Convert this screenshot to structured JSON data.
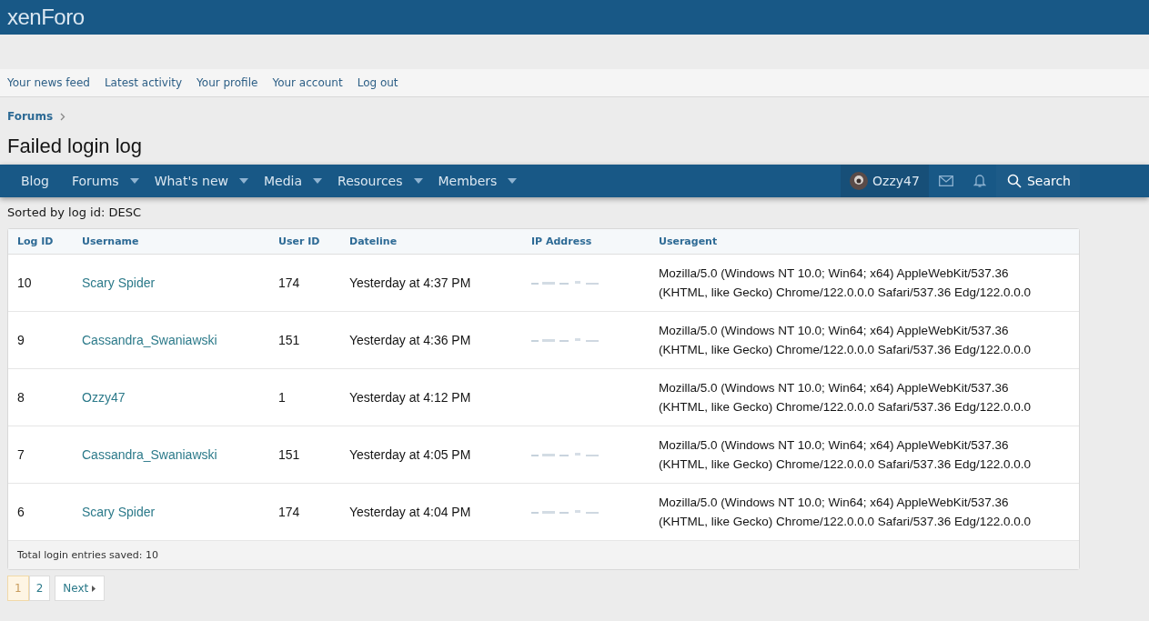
{
  "logo": "xenForo",
  "account_links": [
    {
      "label": "Your news feed"
    },
    {
      "label": "Latest activity"
    },
    {
      "label": "Your profile"
    },
    {
      "label": "Your account"
    },
    {
      "label": "Log out"
    }
  ],
  "breadcrumb": "Forums",
  "title": "Failed login log",
  "nav": [
    {
      "label": "Blog",
      "has_menu": false
    },
    {
      "label": "Forums",
      "has_menu": true
    },
    {
      "label": "What's new",
      "has_menu": true
    },
    {
      "label": "Media",
      "has_menu": true
    },
    {
      "label": "Resources",
      "has_menu": true
    },
    {
      "label": "Members",
      "has_menu": true
    }
  ],
  "user": {
    "name": "Ozzy47"
  },
  "search_label": "Search",
  "sort_note": "Sorted by log id: DESC",
  "table": {
    "columns": [
      "Log ID",
      "Username",
      "User ID",
      "Dateline",
      "IP Address",
      "Useragent"
    ],
    "rows": [
      {
        "log_id": "10",
        "username": "Scary Spider",
        "user_id": "174",
        "dateline": "Yesterday at 4:37 PM",
        "ip_masked": true,
        "useragent": "Mozilla/5.0 (Windows NT 10.0; Win64; x64) AppleWebKit/537.36 (KHTML, like Gecko) Chrome/122.0.0.0 Safari/537.36 Edg/122.0.0.0"
      },
      {
        "log_id": "9",
        "username": "Cassandra_Swaniawski",
        "user_id": "151",
        "dateline": "Yesterday at 4:36 PM",
        "ip_masked": true,
        "useragent": "Mozilla/5.0 (Windows NT 10.0; Win64; x64) AppleWebKit/537.36 (KHTML, like Gecko) Chrome/122.0.0.0 Safari/537.36 Edg/122.0.0.0"
      },
      {
        "log_id": "8",
        "username": "Ozzy47",
        "user_id": "1",
        "dateline": "Yesterday at 4:12 PM",
        "ip_masked": false,
        "useragent": "Mozilla/5.0 (Windows NT 10.0; Win64; x64) AppleWebKit/537.36 (KHTML, like Gecko) Chrome/122.0.0.0 Safari/537.36 Edg/122.0.0.0"
      },
      {
        "log_id": "7",
        "username": "Cassandra_Swaniawski",
        "user_id": "151",
        "dateline": "Yesterday at 4:05 PM",
        "ip_masked": true,
        "useragent": "Mozilla/5.0 (Windows NT 10.0; Win64; x64) AppleWebKit/537.36 (KHTML, like Gecko) Chrome/122.0.0.0 Safari/537.36 Edg/122.0.0.0"
      },
      {
        "log_id": "6",
        "username": "Scary Spider",
        "user_id": "174",
        "dateline": "Yesterday at 4:04 PM",
        "ip_masked": true,
        "useragent": "Mozilla/5.0 (Windows NT 10.0; Win64; x64) AppleWebKit/537.36 (KHTML, like Gecko) Chrome/122.0.0.0 Safari/537.36 Edg/122.0.0.0"
      }
    ],
    "footer": "Total login entries saved: 10"
  },
  "pagination": {
    "pages": [
      {
        "label": "1",
        "selected": true
      },
      {
        "label": "2",
        "selected": false
      }
    ],
    "next": "Next"
  }
}
